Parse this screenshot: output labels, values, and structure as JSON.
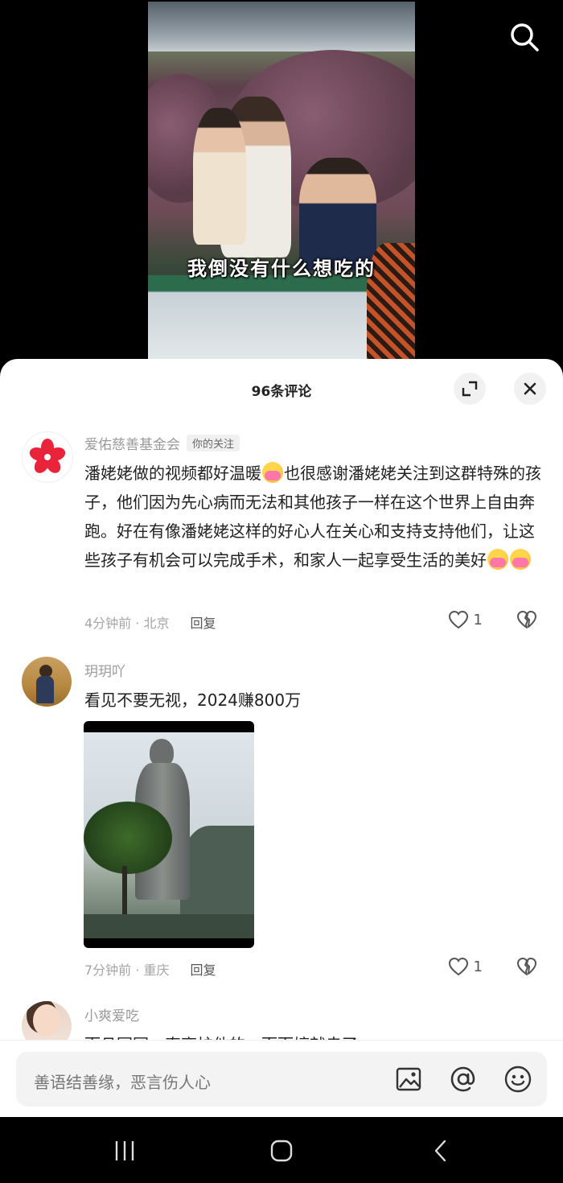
{
  "video": {
    "subtitle": "我倒没有什么想吃的"
  },
  "comments_panel": {
    "title": "96条评论"
  },
  "comments": [
    {
      "user": "爱佑慈善基金会",
      "tag": "你的关注",
      "text_part1": "潘姥姥做的视频都好温暖",
      "text_part2": "也很感谢潘姥姥关注到这群特殊的孩子，他们因为先心病而无法和其他孩子一样在这个世界上自由奔跑。好在有像潘姥姥这样的好心人在关心和支持支持他们，让这些孩子有机会可以完成手术，和家人一起享受生活的美好",
      "time_location": "4分钟前 · 北京",
      "reply_label": "回复",
      "likes": "1"
    },
    {
      "user": "玥玥吖",
      "text": "看见不要无视，2024赚800万",
      "time_location": "7分钟前 · 重庆",
      "reply_label": "回复",
      "likes": "1"
    },
    {
      "user": "小爽爱吃",
      "text": "而且园园一直离护他的，而而婷就走了"
    }
  ],
  "input": {
    "placeholder": "善语结善缘，恶言伤人心"
  },
  "colors": {
    "accent_red": "#e8233a",
    "sheet_bg": "#ffffff",
    "muted_text": "#9a9a9a"
  }
}
